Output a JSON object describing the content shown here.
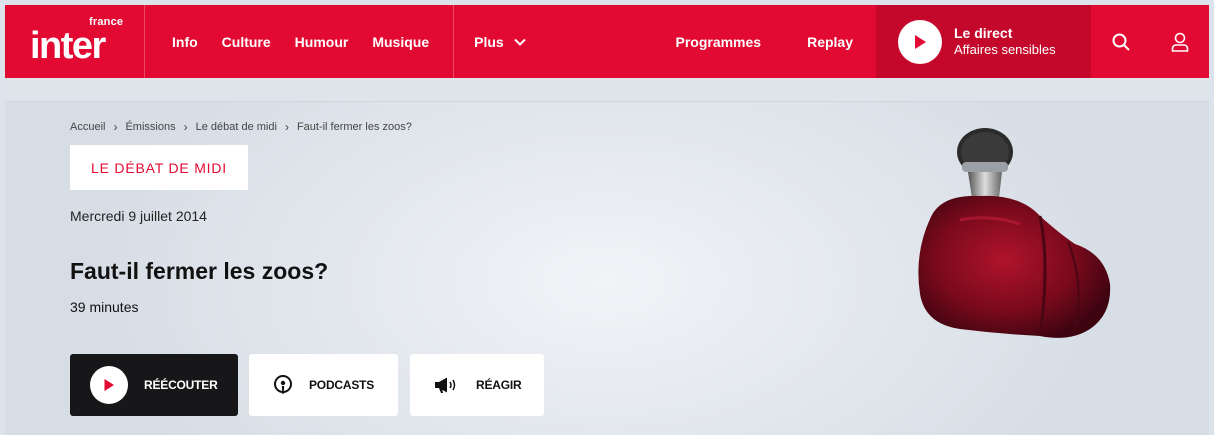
{
  "header": {
    "logo_small": "france",
    "logo_main": "inter",
    "nav": [
      {
        "label": "Info"
      },
      {
        "label": "Culture"
      },
      {
        "label": "Humour"
      },
      {
        "label": "Musique"
      }
    ],
    "more_label": "Plus",
    "programmes_label": "Programmes",
    "replay_label": "Replay",
    "live": {
      "title": "Le direct",
      "subtitle": "Affaires sensibles"
    },
    "icons": [
      "search-icon",
      "user-icon"
    ],
    "colors": {
      "brand": "#e20a32",
      "live_bg": "#c4082b"
    }
  },
  "breadcrumb": [
    "Accueil",
    "Émissions",
    "Le débat de midi",
    "Faut-il fermer les zoos?"
  ],
  "show": {
    "badge": "LE DÉBAT DE MIDI",
    "date": "Mercredi 9 juillet 2014",
    "title": "Faut-il fermer les zoos?",
    "duration": "39 minutes"
  },
  "actions": {
    "listen": "RÉÉCOUTER",
    "podcasts": "PODCASTS",
    "react": "RÉAGIR"
  },
  "illustration": "boxing-glove-microphone"
}
